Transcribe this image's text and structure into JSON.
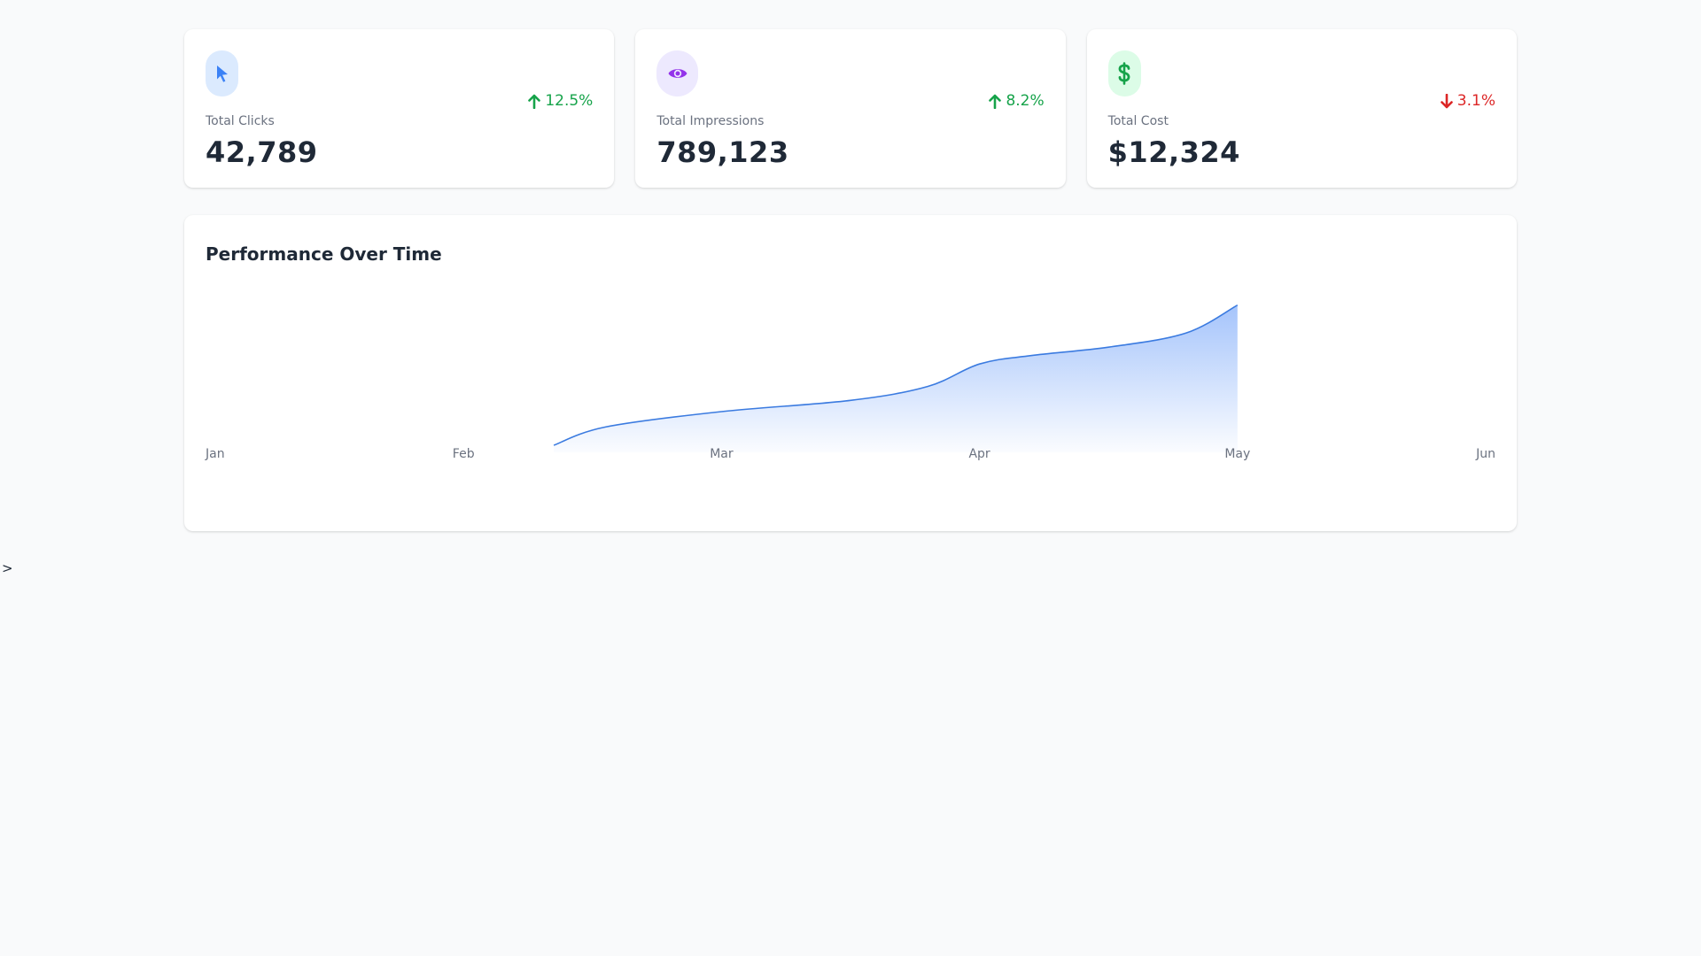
{
  "stats": [
    {
      "label": "Total Clicks",
      "value": "42,789",
      "change": "12.5%",
      "trend": "up",
      "icon": "cursor-pointer-icon",
      "accent": "#3b82f6",
      "icon_bg": "#dbeafe",
      "change_color": "#16a34a"
    },
    {
      "label": "Total Impressions",
      "value": "789,123",
      "change": "8.2%",
      "trend": "up",
      "icon": "eye-icon",
      "accent": "#9333ea",
      "icon_bg": "#ede9fe",
      "change_color": "#16a34a"
    },
    {
      "label": "Total Cost",
      "value": "$12,324",
      "change": "3.1%",
      "trend": "down",
      "icon": "dollar-icon",
      "accent": "#16a34a",
      "icon_bg": "#dcfce7",
      "change_color": "#dc2626"
    }
  ],
  "chart_section": {
    "title": "Performance Over Time"
  },
  "chart_data": {
    "type": "area",
    "title": "Performance Over Time",
    "x": [
      "Jan",
      "Feb",
      "Mar",
      "Apr",
      "May",
      "Jun"
    ],
    "series": [
      {
        "points": [
          {
            "x": 1.35,
            "y": 0
          },
          {
            "x": 1.55,
            "y": 0.13
          },
          {
            "x": 2.0,
            "y": 0.24
          },
          {
            "x": 2.5,
            "y": 0.32
          },
          {
            "x": 2.8,
            "y": 0.42
          },
          {
            "x": 3.0,
            "y": 0.58
          },
          {
            "x": 3.2,
            "y": 0.64
          },
          {
            "x": 3.5,
            "y": 0.7
          },
          {
            "x": 3.8,
            "y": 0.8
          },
          {
            "x": 4.0,
            "y": 1.0
          }
        ]
      }
    ],
    "xlim": [
      0,
      5
    ],
    "ylim": [
      0,
      1.2
    ],
    "grid": false,
    "line_color": "#3b7be0",
    "fill_color": "#a5c4fb"
  },
  "stray_text": ">"
}
